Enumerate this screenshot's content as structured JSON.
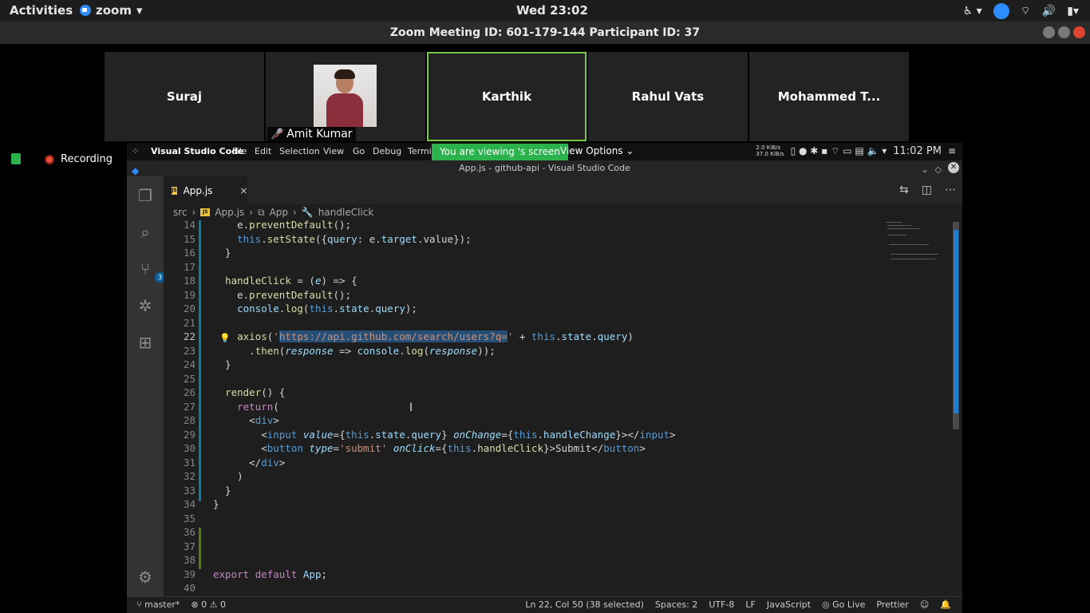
{
  "topbar": {
    "activities": "Activities",
    "app": "zoom",
    "clock": "Wed 23:02"
  },
  "zoom_title": "Zoom Meeting ID: 601-179-144 Participant ID: 37",
  "participants": [
    {
      "name": "Suraj"
    },
    {
      "name": "Amit Kumar",
      "video": true
    },
    {
      "name": "Karthik",
      "active": true
    },
    {
      "name": "Rahul Vats"
    },
    {
      "name": "Mohammed T..."
    }
  ],
  "recording_label": "Recording",
  "remote_menubar": {
    "app": "Visual Studio Code",
    "menus": [
      "File",
      "Edit",
      "Selection",
      "View",
      "Go",
      "Debug",
      "Termi"
    ],
    "banner": "You are viewing 's screen",
    "view_options": "View Options",
    "net_down": "2.0 KiB/s",
    "net_up": "37.0 KiB/s",
    "time": "11:02 PM"
  },
  "window_title": "App.js - github-api - Visual Studio Code",
  "tab": {
    "label": "App.js",
    "close": "×"
  },
  "breadcrumb": [
    "src",
    "App.js",
    "App",
    "handleClick"
  ],
  "code_lines": [
    {
      "n": "14",
      "html": "    e.preventDefault();"
    },
    {
      "n": "15",
      "html": "    this.setState({query: e.target.value});"
    },
    {
      "n": "16",
      "html": "  }"
    },
    {
      "n": "17",
      "html": ""
    },
    {
      "n": "18",
      "html": "  handleClick = (e) => {"
    },
    {
      "n": "19",
      "html": "    e.preventDefault();"
    },
    {
      "n": "20",
      "html": "    console.log(this.state.query);"
    },
    {
      "n": "21",
      "html": ""
    },
    {
      "n": "22",
      "html": "    axios('https://api.github.com/search/users?q=' + this.state.query)"
    },
    {
      "n": "23",
      "html": "      .then(response => console.log(response));"
    },
    {
      "n": "24",
      "html": "  }"
    },
    {
      "n": "25",
      "html": ""
    },
    {
      "n": "26",
      "html": "  render() {"
    },
    {
      "n": "27",
      "html": "    return("
    },
    {
      "n": "28",
      "html": "      <div>"
    },
    {
      "n": "29",
      "html": "        <input value={this.state.query} onChange={this.handleChange}></input>"
    },
    {
      "n": "30",
      "html": "        <button type='submit' onClick={this.handleClick}>Submit</button>"
    },
    {
      "n": "31",
      "html": "      </div>"
    },
    {
      "n": "32",
      "html": "    )"
    },
    {
      "n": "33",
      "html": "  }"
    },
    {
      "n": "34",
      "html": "}"
    },
    {
      "n": "35",
      "html": ""
    },
    {
      "n": "36",
      "html": ""
    },
    {
      "n": "37",
      "html": ""
    },
    {
      "n": "38",
      "html": ""
    },
    {
      "n": "39",
      "html": "export default App;"
    },
    {
      "n": "40",
      "html": ""
    }
  ],
  "statusbar": {
    "branch": "master*",
    "errors": "0",
    "warnings": "0",
    "position": "Ln 22, Col 50 (38 selected)",
    "spaces": "Spaces: 2",
    "encoding": "UTF-8",
    "eol": "LF",
    "language": "JavaScript",
    "golive": "Go Live",
    "prettier": "Prettier"
  },
  "colors": {
    "zoom_blue": "#2d8cff",
    "active_green": "#7ac943",
    "vscode_bg": "#1e1e1e"
  }
}
